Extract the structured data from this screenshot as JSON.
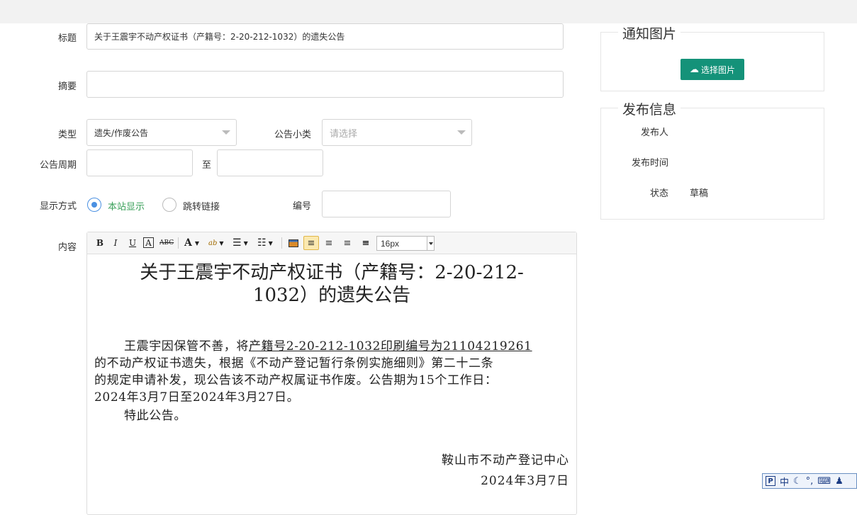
{
  "form": {
    "title_label": "标题",
    "title_value": "关于王震宇不动产权证书（产籍号：2-20-212-1032）的遗失公告",
    "summary_label": "摘要",
    "summary_value": "",
    "type_label": "类型",
    "type_value": "遗失/作废公告",
    "subtype_label": "公告小类",
    "subtype_placeholder": "请选择",
    "period_label": "公告周期",
    "period_to": "至",
    "display_label": "显示方式",
    "display_option_1": "本站显示",
    "display_option_2": "跳转链接",
    "number_label": "编号",
    "content_label": "内容"
  },
  "toolbar": {
    "bold": "B",
    "italic": "I",
    "underline": "U",
    "border": "A",
    "strike": "ABC",
    "font_color": "A",
    "highlight": "ab",
    "font_size": "16px"
  },
  "doc": {
    "title_line1": "关于王震宇不动产权证书（产籍号：2-20-212-",
    "title_line2": "1032）的遗失公告",
    "p1_lead": "王震宇因保管不善，将",
    "p1_underline": "产籍号2-20-212-1032印刷编号为21104219261",
    "p1_rest_1": "的不动产权证书遗失，根据《不动产登记暂行条例实施细则》第二十二条",
    "p1_rest_2": "的规定申请补发，现公告该不动产权属证书作废。公告期为15个工作日：",
    "p1_rest_3": "2024年3月7日至2024年3月27日。",
    "p2": "特此公告。",
    "sign_org": "鞍山市不动产登记中心",
    "sign_date": "2024年3月7日"
  },
  "side": {
    "image_legend": "通知图片",
    "image_button": "选择图片",
    "publish_legend": "发布信息",
    "publisher_label": "发布人",
    "publish_time_label": "发布时间",
    "status_label": "状态",
    "status_value": "草稿"
  },
  "ime": {
    "mode": "中"
  },
  "colors": {
    "accent_green": "#149279",
    "radio_blue": "#4a90e2",
    "radio_label_green": "#3aa05a"
  }
}
